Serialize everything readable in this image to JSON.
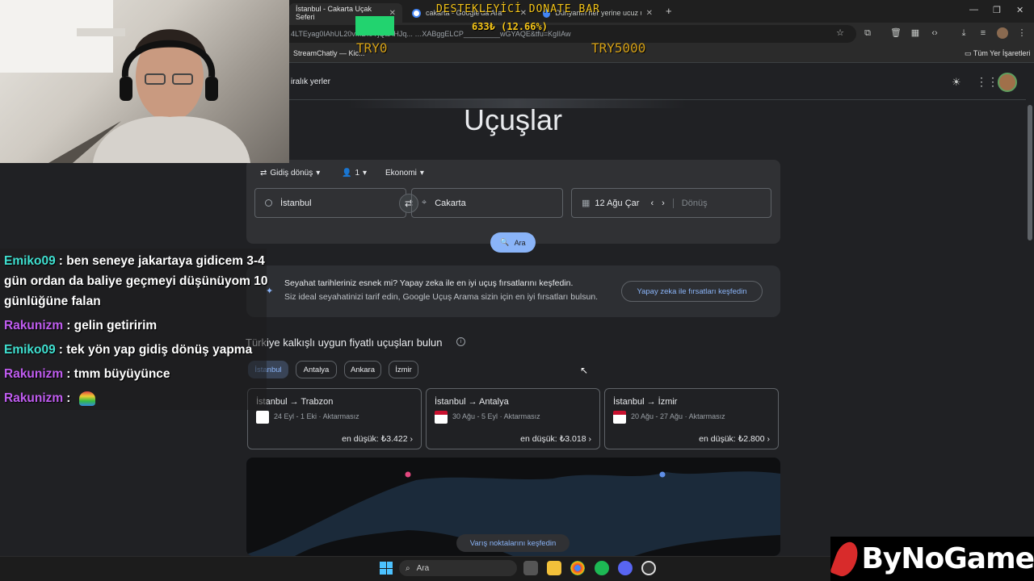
{
  "browser": {
    "tabs": [
      {
        "label": "İstanbul - Cakarta Uçak Seferi"
      },
      {
        "label": "cakarta - Google'da Ara"
      },
      {
        "label": "Dünyanın her yerine ucuz uçuş"
      }
    ],
    "new_tab": "+",
    "url": "4LTEyag0IAhUL20vMDI0YjQaAHJq... …XABggELCP_________wGYAQE&tfu=KgIIAw",
    "bookmarks": {
      "left": "StreamChatly — Kic...",
      "right": "Tüm Yer İşaretleri"
    }
  },
  "overlay": {
    "donate_title": "DESTEKLEYİCİ DONATE BAR",
    "donate_amount": "633₺ (12.66%)",
    "progress": 12.66,
    "try_min": "TRY0",
    "try_max": "TRY5000"
  },
  "gheader": {
    "nav_item": "iralık yerler"
  },
  "main": {
    "title": "Uçuşlar",
    "options": {
      "trip": "Gidiş dönüş",
      "passengers": "1",
      "class": "Ekonomi"
    },
    "origin": "İstanbul",
    "destination": "Cakarta",
    "depart_date": "12 Ağu Çar",
    "return_placeholder": "Dönüş",
    "search_label": "Ara"
  },
  "ai_banner": {
    "title": "Seyahat tarihleriniz esnek mi? Yapay zeka ile en iyi uçuş fırsatlarını keşfedin.",
    "subtitle": "Siz ideal seyahatinizi tarif edin, Google Uçuş Arama sizin için en iyi fırsatları bulsun.",
    "button": "Yapay zeka ile fırsatları keşfedin"
  },
  "cheap": {
    "title": "Türkiye kalkışlı uygun fiyatlı uçuşları bulun",
    "chips": [
      "İstanbul",
      "Antalya",
      "Ankara",
      "İzmir"
    ],
    "routes": [
      {
        "route": "İstanbul → Trabzon",
        "dates": "24 Eyl - 1 Eki",
        "stops": "Aktarmasız",
        "price": "en düşük: ₺3.422"
      },
      {
        "route": "İstanbul → Antalya",
        "dates": "30 Ağu - 5 Eyl",
        "stops": "Aktarmasız",
        "price": "en düşük: ₺3.018"
      },
      {
        "route": "İstanbul → İzmir",
        "dates": "20 Ağu - 27 Ağu",
        "stops": "Aktarmasız",
        "price": "en düşük: ₺2.800"
      }
    ],
    "explore_button": "Varış noktalarını keşfedin",
    "separator": "·"
  },
  "chat": [
    {
      "user": "Emiko09",
      "color": "#3fe0d0",
      "text": ": ben seneye jakartaya gidicem 3-4",
      "line2": "gün ordan da baliye geçmeyi düşünüyom 10",
      "line3": "günlüğüne falan"
    },
    {
      "user": "Rakunizm",
      "color": "#c05cf0",
      "text": ": gelin getiririm"
    },
    {
      "user": "Emiko09",
      "color": "#3fe0d0",
      "text": ": tek yön yap gidiş dönüş yapma"
    },
    {
      "user": "Rakunizm",
      "color": "#c05cf0",
      "text": ": tmm büyüyünce"
    },
    {
      "user": "Rakunizm",
      "color": "#c05cf0",
      "text": ":"
    }
  ],
  "taskbar": {
    "search": "Ara"
  },
  "brand": {
    "name": "ByNoGame"
  }
}
